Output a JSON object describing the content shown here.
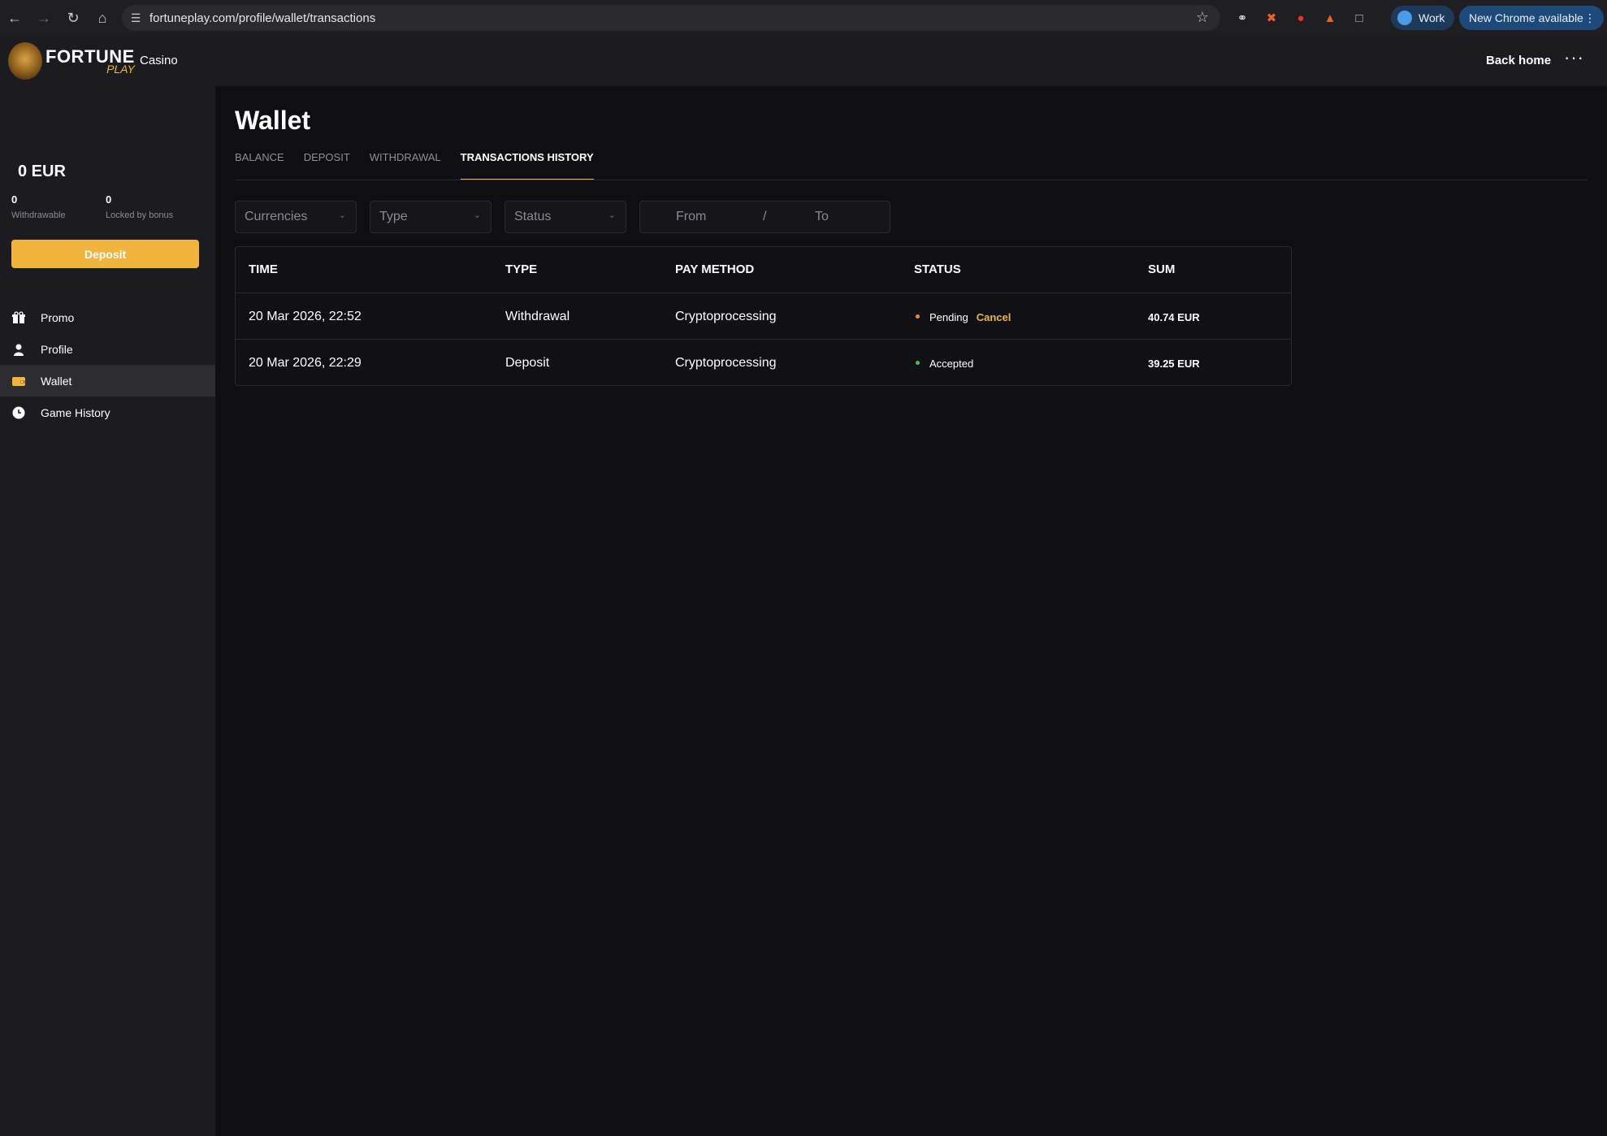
{
  "browser": {
    "url": "fortuneplay.com/profile/wallet/transactions",
    "profile_label": "Work",
    "update_label": "New Chrome available"
  },
  "header": {
    "logo_line1": "FORTUNE",
    "logo_line2": "PLAY",
    "casino_label": "Casino",
    "back_home_label": "Back home"
  },
  "sidebar": {
    "balance": "0  EUR",
    "withdrawable_value": "0",
    "withdrawable_label": "Withdrawable",
    "locked_value": "0",
    "locked_label": "Locked by bonus",
    "deposit_label": "Deposit",
    "items": [
      {
        "label": "Promo",
        "icon": "gift-icon"
      },
      {
        "label": "Profile",
        "icon": "user-icon"
      },
      {
        "label": "Wallet",
        "icon": "wallet-icon",
        "active": true
      },
      {
        "label": "Game History",
        "icon": "clock-icon"
      }
    ]
  },
  "main": {
    "title": "Wallet",
    "tabs": [
      {
        "label": "BALANCE"
      },
      {
        "label": "DEPOSIT"
      },
      {
        "label": "WITHDRAWAL"
      },
      {
        "label": "TRANSACTIONS HISTORY",
        "active": true
      }
    ],
    "filters": {
      "currencies": "Currencies",
      "type": "Type",
      "status": "Status",
      "from": "From",
      "separator": "/",
      "to": "To"
    },
    "table": {
      "headers": [
        "TIME",
        "TYPE",
        "PAY METHOD",
        "STATUS",
        "SUM"
      ],
      "rows": [
        {
          "time": "20 Mar 2026, 22:52",
          "type": "Withdrawal",
          "method": "Cryptoprocessing",
          "status": "Pending",
          "action": "Cancel",
          "sum": "40.74 EUR",
          "status_color": "#f08a3c"
        },
        {
          "time": "20 Mar 2026, 22:29",
          "type": "Deposit",
          "method": "Cryptoprocessing",
          "status": "Accepted",
          "sum": "39.25 EUR",
          "status_color": "#3ec45a"
        }
      ]
    }
  },
  "colors": {
    "accent": "#f1b43d",
    "background": "#0f0f13",
    "panel": "#1c1c20"
  }
}
